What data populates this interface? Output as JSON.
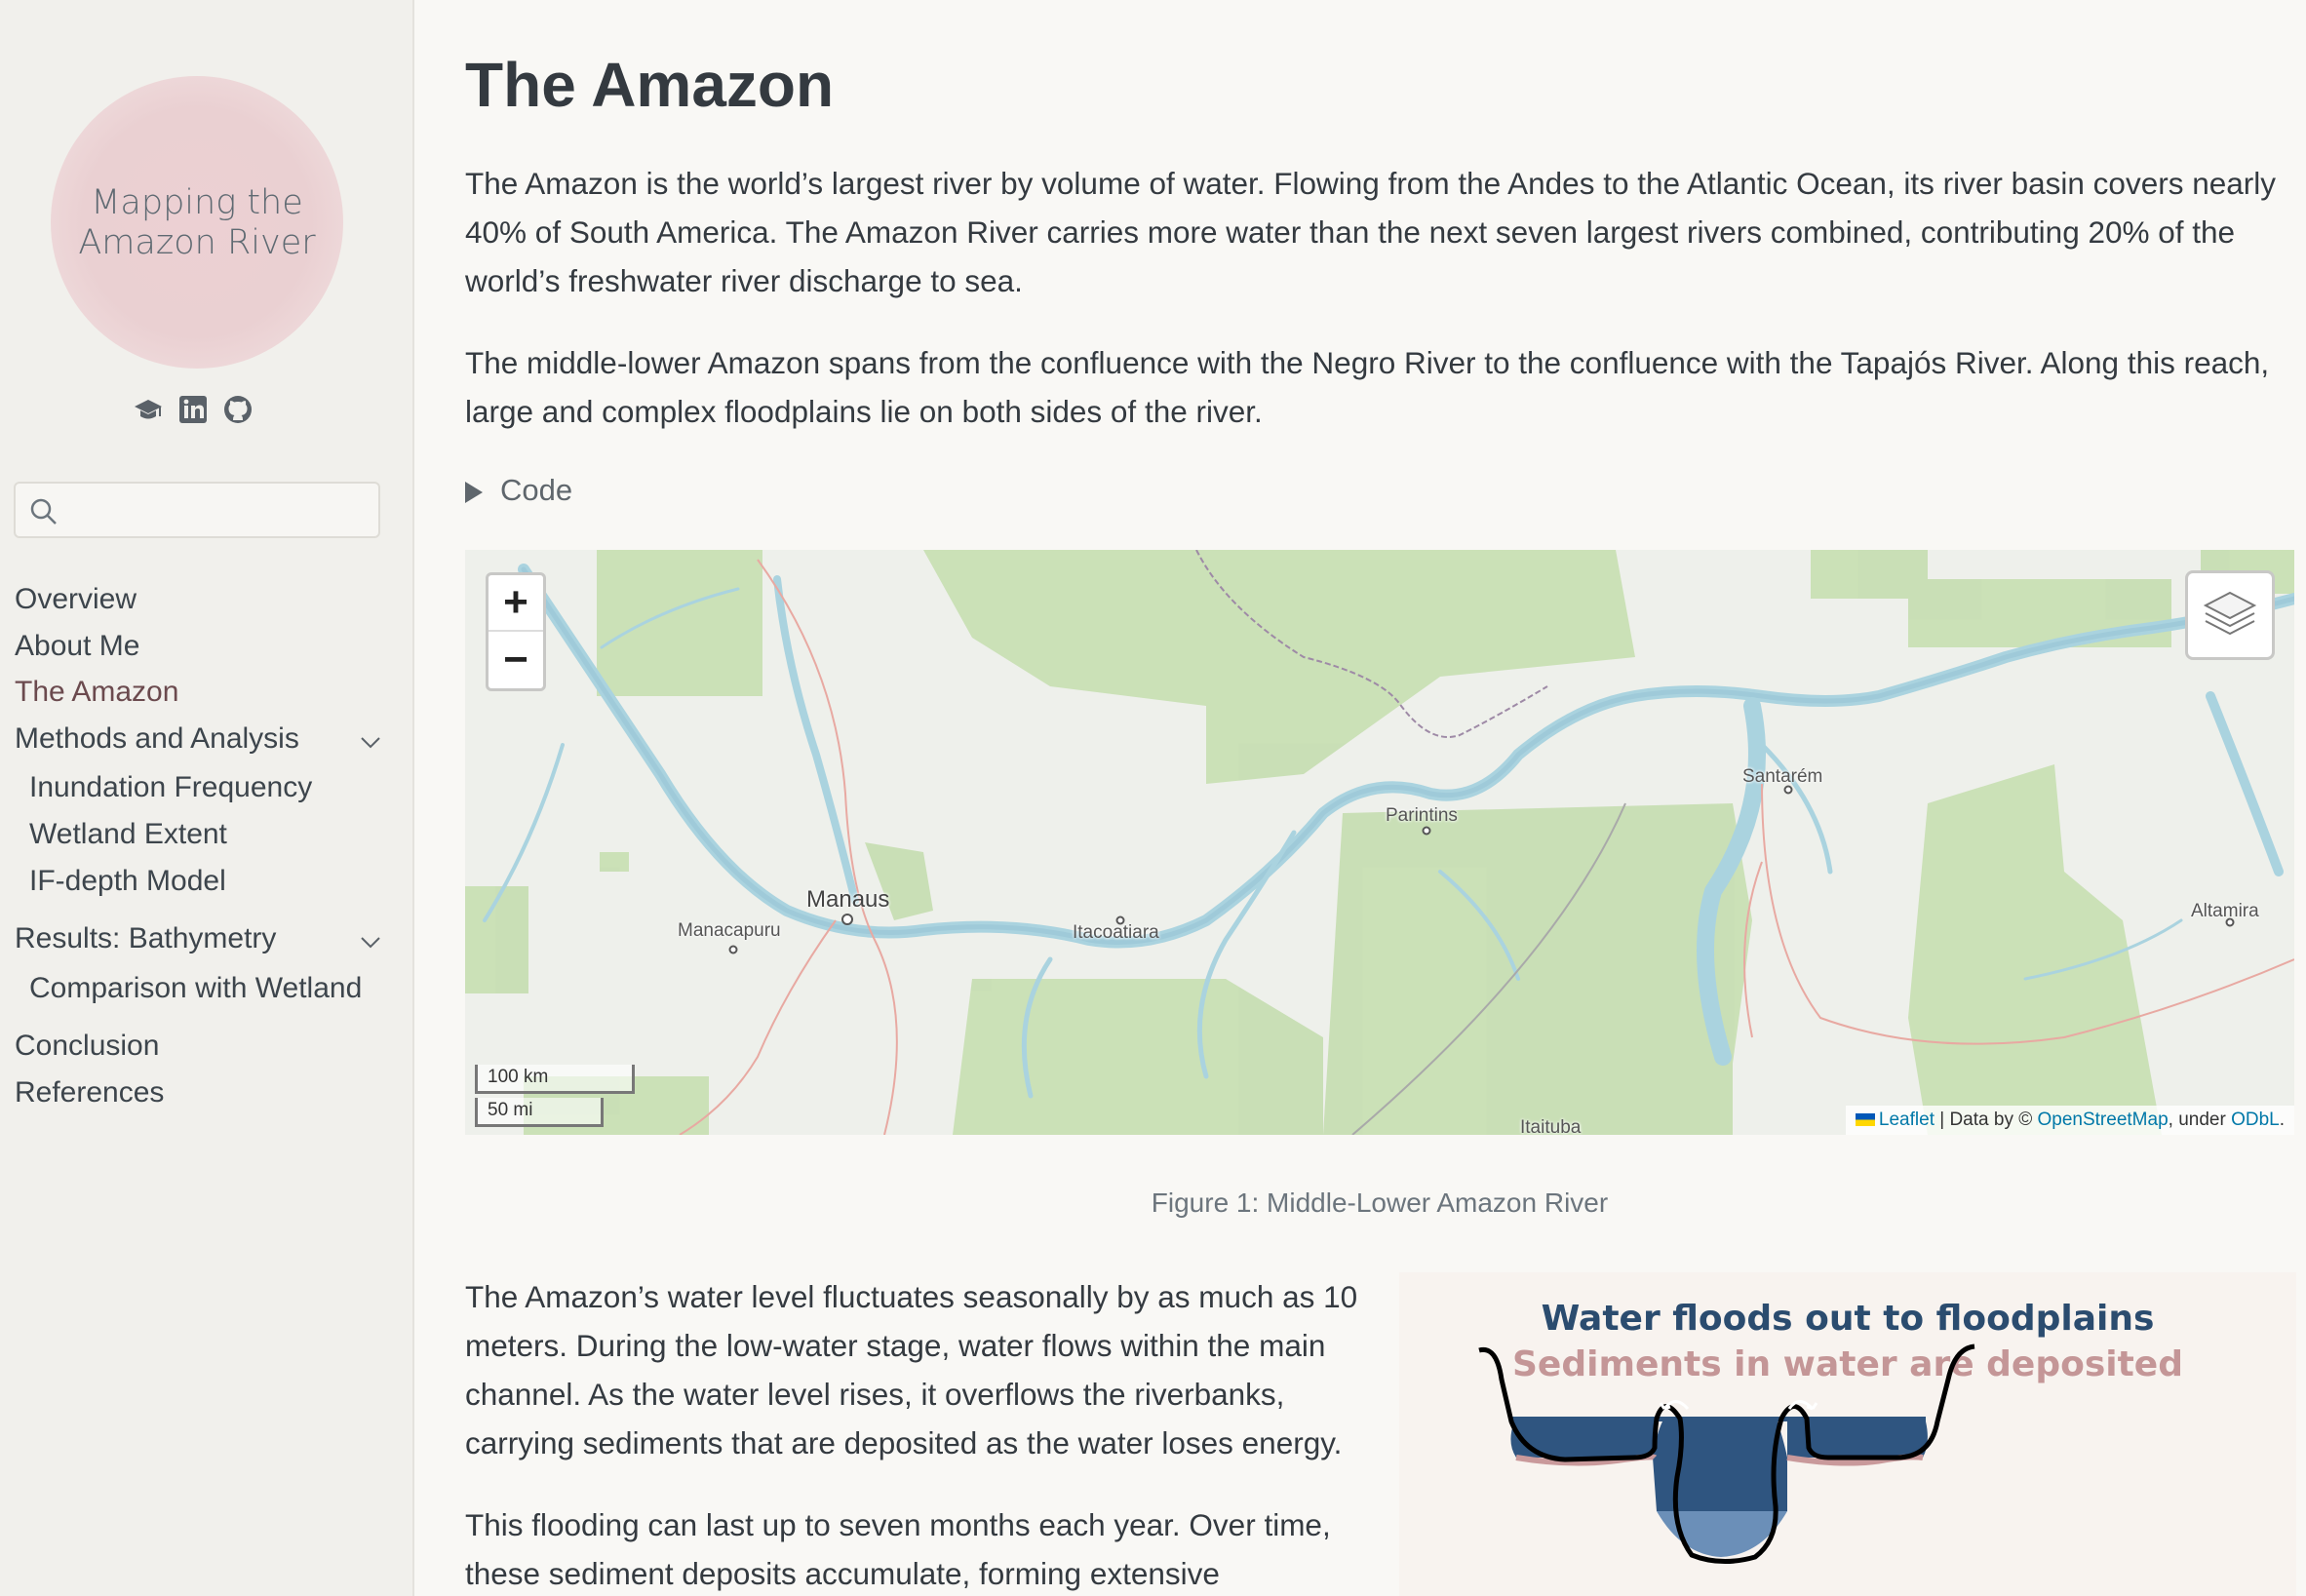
{
  "sidebar": {
    "logo_line1": "Mapping the",
    "logo_line2": "Amazon River",
    "search_placeholder": "",
    "nav": [
      {
        "label": "Overview"
      },
      {
        "label": "About Me"
      },
      {
        "label": "The Amazon",
        "active": true
      },
      {
        "label": "Methods and Analysis"
      },
      {
        "label": "Inundation Frequency"
      },
      {
        "label": "Wetland Extent"
      },
      {
        "label": "IF-depth Model"
      },
      {
        "label": "Results: Bathymetry"
      },
      {
        "label": "Comparison with Wetland"
      },
      {
        "label": "Conclusion"
      },
      {
        "label": "References"
      }
    ]
  },
  "main": {
    "title": "The Amazon",
    "para1": "The Amazon is the world’s largest river by volume of water. Flowing from the Andes to the Atlantic Ocean, its river basin covers nearly 40% of South America. The Amazon River carries more water than the next seven largest rivers combined, contributing 20% of the world’s freshwater river discharge to sea.",
    "para2": "The middle-lower Amazon spans from the confluence with the Negro River to the confluence with the Tapajós River. Along this reach, large and complex floodplains lie on both sides of the river.",
    "code_label": "Code",
    "map": {
      "zoom_in": "+",
      "zoom_out": "−",
      "scale_km": "100 km",
      "scale_mi": "50 mi",
      "attrib_leaflet": "Leaflet",
      "attrib_mid": " | Data by © ",
      "attrib_osm": "OpenStreetMap",
      "attrib_under": ", under ",
      "attrib_odbl": "ODbL",
      "attrib_end": ".",
      "cities": [
        "Manaus",
        "Manacapuru",
        "Itacoatiara",
        "Parintins",
        "Santarém",
        "Altamira",
        "Itaituba"
      ]
    },
    "caption": "Figure 1: Middle-Lower Amazon River",
    "para3": "The Amazon’s water level fluctuates seasonally by as much as 10 meters. During the low-water stage, water flows within the main channel. As the water level rises, it overflows the riverbanks, carrying sediments that are deposited as the water loses energy.",
    "para4": "This flooding can last up to seven months each year. Over time, these sediment deposits accumulate, forming extensive",
    "diagram_title1": "Water floods out to floodplains",
    "diagram_title2": "Sediments in water are deposited"
  },
  "colors": {
    "accent": "#6b4a4e",
    "link": "#0078a8",
    "water": "#aad3df",
    "forest": "#c8dfb4"
  }
}
